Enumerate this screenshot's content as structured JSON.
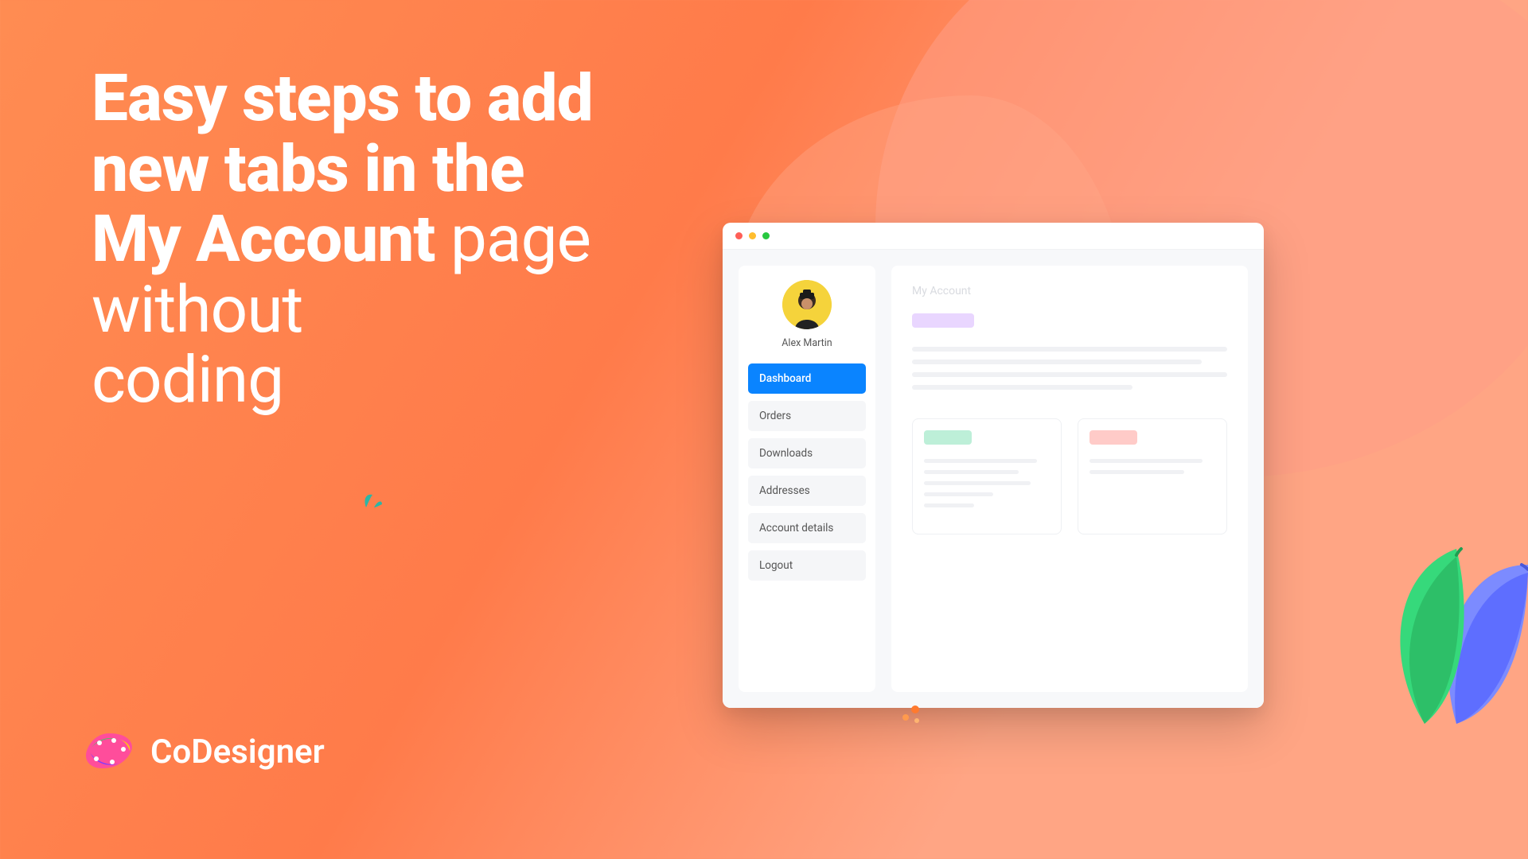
{
  "headline": {
    "line1_bold": "Easy steps to add",
    "line2_bold": "new tabs in the",
    "line3_bold": "My Account",
    "line3_light_tail": "page without",
    "line4_light": "coding"
  },
  "brand": {
    "name": "CoDesigner"
  },
  "window": {
    "sidebar": {
      "username": "Alex Martin",
      "items": [
        {
          "label": "Dashboard",
          "active": true
        },
        {
          "label": "Orders",
          "active": false
        },
        {
          "label": "Downloads",
          "active": false
        },
        {
          "label": "Addresses",
          "active": false
        },
        {
          "label": "Account details",
          "active": false
        },
        {
          "label": "Logout",
          "active": false
        }
      ]
    },
    "content": {
      "title": "My Account"
    }
  }
}
